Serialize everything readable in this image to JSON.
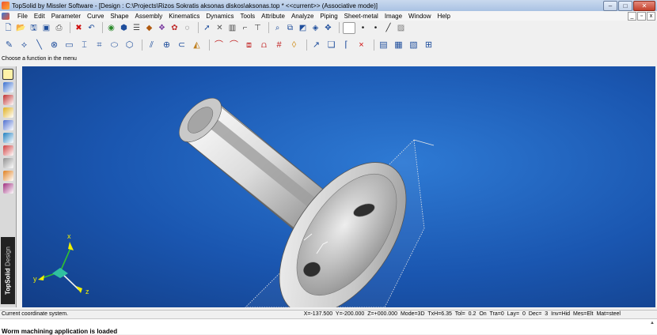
{
  "window": {
    "title": "TopSolid by Missler Software - [Design : C:\\Projects\\Rizos Sokratis aksonas diskos\\aksonas.top *  <<current>> (Associative mode)]",
    "controls": {
      "minimize": "–",
      "maximize": "□",
      "close": "✕"
    }
  },
  "menubar": {
    "items": [
      "File",
      "Edit",
      "Parameter",
      "Curve",
      "Shape",
      "Assembly",
      "Kinematics",
      "Dynamics",
      "Tools",
      "Attribute",
      "Analyze",
      "Piping",
      "Sheet-metal",
      "Image",
      "Window",
      "Help"
    ],
    "mdi_controls": {
      "minimize": "_",
      "restore": "▫",
      "close": "x"
    }
  },
  "toolbar_top": {
    "icons": [
      {
        "name": "new-document-icon",
        "glyph": "🗋",
        "color": "#1f4e9c"
      },
      {
        "name": "open-folder-icon",
        "glyph": "📂",
        "color": "#d89b1e"
      },
      {
        "name": "save-icon",
        "glyph": "🖫",
        "color": "#1f4e9c"
      },
      {
        "name": "save-all-icon",
        "glyph": "▣",
        "color": "#1f4e9c"
      },
      {
        "name": "print-icon",
        "glyph": "⎙",
        "color": "#555555"
      },
      {
        "name": "delete-icon",
        "glyph": "✖",
        "color": "#d01010"
      },
      {
        "name": "undo-icon",
        "glyph": "↶",
        "color": "#1f4e9c"
      },
      {
        "name": "shading-icon",
        "glyph": "◉",
        "color": "#2a8a2a"
      },
      {
        "name": "render-icon",
        "glyph": "⬢",
        "color": "#1f4e9c"
      },
      {
        "name": "layers-icon",
        "glyph": "☰",
        "color": "#444444"
      },
      {
        "name": "materials-icon",
        "glyph": "◆",
        "color": "#b05a10"
      },
      {
        "name": "attributes-icon",
        "glyph": "❖",
        "color": "#7a3aa0"
      },
      {
        "name": "colors-icon",
        "glyph": "✿",
        "color": "#c03030"
      },
      {
        "name": "measure-icon",
        "glyph": "◌",
        "color": "#333333"
      },
      {
        "name": "pointer-icon",
        "glyph": "➚",
        "color": "#1f4e9c"
      },
      {
        "name": "cross-icon",
        "glyph": "✕",
        "color": "#555555"
      },
      {
        "name": "histogram-icon",
        "glyph": "▥",
        "color": "#444444"
      },
      {
        "name": "hook-icon",
        "glyph": "⌐",
        "color": "#444444"
      },
      {
        "name": "filter-icon",
        "glyph": "⊤",
        "color": "#444444"
      },
      {
        "name": "zoom-icon",
        "glyph": "⌕",
        "color": "#1f4e9c"
      },
      {
        "name": "zoom-window-icon",
        "glyph": "⧉",
        "color": "#1f4e9c"
      },
      {
        "name": "view-icon",
        "glyph": "◩",
        "color": "#1f4e9c"
      },
      {
        "name": "rotate-view-icon",
        "glyph": "◈",
        "color": "#1f4e9c"
      },
      {
        "name": "pan-icon",
        "glyph": "✥",
        "color": "#1f4e9c"
      },
      {
        "name": "color-swatch-icon",
        "glyph": "■",
        "color": "#ffffff"
      },
      {
        "name": "point-style-icon",
        "glyph": "•",
        "color": "#222222"
      },
      {
        "name": "point-size-icon",
        "glyph": "•",
        "color": "#222222"
      },
      {
        "name": "line-type-icon",
        "glyph": "╱",
        "color": "#222222"
      },
      {
        "name": "hatch-icon",
        "glyph": "▨",
        "color": "#777777"
      }
    ]
  },
  "toolbar_bottom": {
    "icons": [
      {
        "name": "sketch-pencil-icon",
        "glyph": "✎",
        "color": "#1f4e9c"
      },
      {
        "name": "point-icon",
        "glyph": "⟡",
        "color": "#1f4e9c"
      },
      {
        "name": "line-icon",
        "glyph": "╲",
        "color": "#1f4e9c"
      },
      {
        "name": "circle-icon",
        "glyph": "⊗",
        "color": "#1f4e9c"
      },
      {
        "name": "rectangle-icon",
        "glyph": "▭",
        "color": "#1f4e9c"
      },
      {
        "name": "polyline-icon",
        "glyph": "⌶",
        "color": "#1f4e9c"
      },
      {
        "name": "trim-icon",
        "glyph": "⌗",
        "color": "#1f4e9c"
      },
      {
        "name": "ellipse-icon",
        "glyph": "⬭",
        "color": "#1f4e9c"
      },
      {
        "name": "polygon-icon",
        "glyph": "⬡",
        "color": "#1f4e9c"
      },
      {
        "name": "parallel-icon",
        "glyph": "⫽",
        "color": "#1f4e9c"
      },
      {
        "name": "axis-icon",
        "glyph": "⊕",
        "color": "#1f4e9c"
      },
      {
        "name": "slot-icon",
        "glyph": "⊂",
        "color": "#1f4e9c"
      },
      {
        "name": "surface-icon",
        "glyph": "◭",
        "color": "#c08020"
      },
      {
        "name": "bend-icon",
        "glyph": "⌒",
        "color": "#c02020"
      },
      {
        "name": "fillet-icon",
        "glyph": "⌒",
        "color": "#c02020"
      },
      {
        "name": "offset-icon",
        "glyph": "⧈",
        "color": "#c02020"
      },
      {
        "name": "profile-icon",
        "glyph": "⩍",
        "color": "#c02020"
      },
      {
        "name": "hatch-pattern-icon",
        "glyph": "#",
        "color": "#c02020"
      },
      {
        "name": "projection-icon",
        "glyph": "◊",
        "color": "#d09020"
      },
      {
        "name": "dimension-icon",
        "glyph": "↗",
        "color": "#1f4e9c"
      },
      {
        "name": "annotation-icon",
        "glyph": "❏",
        "color": "#1f4e9c"
      },
      {
        "name": "frame-icon",
        "glyph": "⌈",
        "color": "#1f4e9c"
      },
      {
        "name": "cancel-x-icon",
        "glyph": "×",
        "color": "#d01010"
      },
      {
        "name": "library-icon",
        "glyph": "▤",
        "color": "#1f4e9c"
      },
      {
        "name": "parts-icon",
        "glyph": "▦",
        "color": "#1f4e9c"
      },
      {
        "name": "assembly-icon",
        "glyph": "▧",
        "color": "#1f4e9c"
      },
      {
        "name": "tree-icon",
        "glyph": "⊞",
        "color": "#1f4e9c"
      }
    ]
  },
  "prompt": "Choose a function in the menu",
  "sidebar": {
    "icons": [
      {
        "name": "sketch-mode-icon",
        "color": "#fff2a8",
        "active": true
      },
      {
        "name": "shape-mode-icon",
        "color": "#3a6fd0",
        "active": false
      },
      {
        "name": "assembly-mode-icon",
        "color": "#c03030",
        "active": false
      },
      {
        "name": "tolerance-mode-icon",
        "color": "#e0b020",
        "active": false
      },
      {
        "name": "kinematics-mode-icon",
        "color": "#5070d0",
        "active": false
      },
      {
        "name": "analysis-mode-icon",
        "color": "#2080c0",
        "active": false
      },
      {
        "name": "mold-mode-icon",
        "color": "#d04040",
        "active": false
      },
      {
        "name": "electrode-mode-icon",
        "color": "#909090",
        "active": false
      },
      {
        "name": "weld-mode-icon",
        "color": "#e08020",
        "active": false
      },
      {
        "name": "drafting-mode-icon",
        "color": "#a03080",
        "active": false
      }
    ],
    "brand": "TopSolid",
    "mode": "Design"
  },
  "viewport": {
    "axis_labels": {
      "x": "x",
      "y": "y",
      "z": "z"
    }
  },
  "status": {
    "left": "Current coordinate system.",
    "right": "X=-137.500  Y=-200.000  Z=+000.000  Mode=3D  TxH=6.35  Tol= 0.2  On Tra=0  Lay= 0  Dec= 3  Inv=Hid  Mes=Elt  Mat=steel"
  },
  "message": "Worm machining application is loaded"
}
